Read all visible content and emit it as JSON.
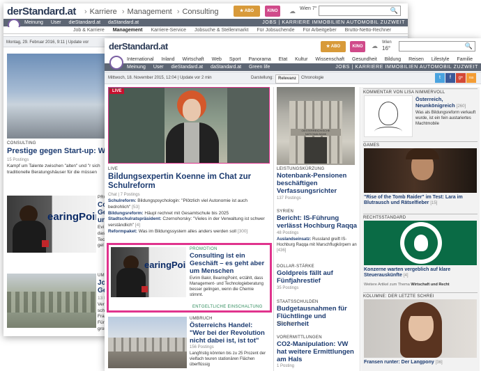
{
  "back": {
    "logo": "derStandard.at",
    "breadcrumb": [
      "Karriere",
      "Management",
      "Consulting"
    ],
    "nav": [
      "Meinung",
      "User",
      "dieStandard.at",
      "daStandard.at"
    ],
    "nav_right": "JOBS | KARRIERE   IMMOBILIEN   AUTOMOBIL   ZUZWEIT",
    "subnav": [
      "Job & Karriere",
      "Management",
      "Karriere-Service",
      "Jobsuche & Stellenmarkt",
      "Für Jobsuchende",
      "Für Arbeitgeber",
      "Brutto-Netto-Rechner"
    ],
    "date": "Montag, 29. Februar 2016, 9:11 | Update vor",
    "article1": {
      "kicker": "CONSULTING",
      "title": "Prestige gegen Start-up: W",
      "postings": "15 Postings",
      "text": "Kampf um Talente zwischen \"alten\" und \"r sich traditionelle Beratungshäuser für die müssen"
    },
    "article2": {
      "kicker": "PRO",
      "title_lines": [
        "Co",
        "Ge",
        "un"
      ],
      "text_lines": [
        "Evi",
        "das",
        "Tec",
        "gel"
      ],
      "photo_text": "earingPoint"
    },
    "article3": {
      "kicker": "UMG",
      "title_lines": [
        "Jol",
        "Ge"
      ],
      "text_lines": [
        "13 P",
        "Ver",
        "schi",
        "Fra",
        "Für",
        "groß"
      ]
    },
    "weather": "Wien 7°"
  },
  "front": {
    "logo": "derStandard.at",
    "weather": {
      "city": "Wien",
      "temp": "16°"
    },
    "mainnav": [
      "International",
      "Inland",
      "Wirtschaft",
      "Web",
      "Sport",
      "Panorama",
      "Etat",
      "Kultur",
      "Wissenschaft",
      "Gesundheit",
      "Bildung",
      "Reisen",
      "Lifestyle",
      "Familie"
    ],
    "nav": [
      "Meinung",
      "User",
      "dieStandard.at",
      "daStandard.at",
      "Green life"
    ],
    "nav_right": "JOBS | KARRIERE   IMMOBILIEN   AUTOMOBIL   ZUZWEIT",
    "date": "Mittwoch, 18. November 2015, 12:04 | Update vor 2 min",
    "darstellung": "Darstellung:",
    "relevanz": "Relevanz",
    "chronologie": "Chronologie",
    "lead": {
      "badge": "LIVE",
      "kicker": "LIVE",
      "title": "Bildungsexpertin Koenne im Chat zur Schulreform",
      "meta": "Chat | 7 Postings",
      "related": [
        {
          "bold": "Schulreform:",
          "text": " Bildungspsychologin: \"Plötzlich viel Autonomie ist auch bedrohlich\"",
          "count": " [53]"
        },
        {
          "bold": "Bildungsreform:",
          "text": " Häupl rechnet mit Gesamtschule bis 2025",
          "count": ""
        },
        {
          "bold": "Stadtschulratspräsident:",
          "text": " Czernohorsky: \"Vieles in der Verwaltung ist schwer verständlich\"",
          "count": " [4]"
        },
        {
          "bold": "Reformpaket:",
          "text": " Was im Bildungssystem alles anders werden soll",
          "count": " [300]"
        }
      ]
    },
    "promo": {
      "kicker": "PROMOTION",
      "title": "Consulting ist ein Geschäft – es geht aber um Menschen",
      "text": "Evrim Bakir, BearingPoint, erzählt, dass Management- und Technologieberatung besser gelingen, wenn die Chemie stimmt.",
      "footer": "ENTGELTLICHE EINSCHALTUNG",
      "photo_text": "earingPoint"
    },
    "umbruch": {
      "kicker": "UMBRUCH",
      "title": "Österreichs Handel: \"Wer bei der Revolution nicht dabei ist, ist tot\"",
      "postings": "156 Postings",
      "text": "Langfristig könnten bis zu 25 Prozent der vielfach teuren stationären Flächen überflüssig"
    },
    "mid": [
      {
        "kicker": "LEISTUNGSKÜRZUNG",
        "title": "Notenbank-Pensionen beschäftigen Verfassungsrichter",
        "postings": "137 Postings"
      },
      {
        "kicker": "SYRIEN",
        "title": "Bericht: IS-Führung verlässt Hochburg Raqqa",
        "postings": "48 Postings",
        "extra_bold": "Auslandseinsatz:",
        "extra": " Russland greift IS-Hochburg Raqqa mit Marschflugkörpern an",
        "extra_count": " [436]"
      },
      {
        "kicker": "DOLLAR-STÄRKE",
        "title": "Goldpreis fällt auf Fünfjahrestief",
        "postings": "35 Postings"
      },
      {
        "kicker": "STAATSSCHULDEN",
        "title": "Budgetausnahmen für Flüchtlinge und Sicherheit",
        "postings": "9 Postings"
      },
      {
        "kicker": "VORERMITTLUNGEN",
        "title": "CO2-Manipulation: VW hat weitere Ermittlungen am Hals",
        "postings": "1 Posting"
      }
    ],
    "photo_sign": "OESTERREICHISCHE NATIONALBANK",
    "right": {
      "kommentar_title": "KOMMENTAR VON LISA NIMMERVOLL",
      "kommentar_head": "Österreich, Neunkönigreich",
      "kommentar_count": "[260]",
      "kommentar_text": "Was als Bildungsreform verkauft wurde, ist ein fein austariertes Machtmobile",
      "games_title": "GAMES",
      "games_head": "\"Rise of the Tomb Raider\" im Test: Lara im Blutrausch und Rätselfieber",
      "games_count": "[15]",
      "recht_title": "RECHTSSTANDARD",
      "recht_head": "Konzerne warten vergeblich auf klare Steuerauskünfte",
      "recht_count": "[4]",
      "recht_more": "Weitere Artikel zum Thema ",
      "recht_more_bold": "Wirtschaft und Recht",
      "kolumne_title": "KOLUMNE: DER LETZTE SCHREI",
      "kolumne_head": "Fransen runter: Der Langpony",
      "kolumne_count": "[36]"
    },
    "social": [
      "t",
      "f",
      "g+",
      "rss"
    ]
  },
  "colors": {
    "navy": "#1c3b70",
    "nav_grey": "#5d6674",
    "promo_border": "#e0338d",
    "live_red": "#c8102e"
  }
}
